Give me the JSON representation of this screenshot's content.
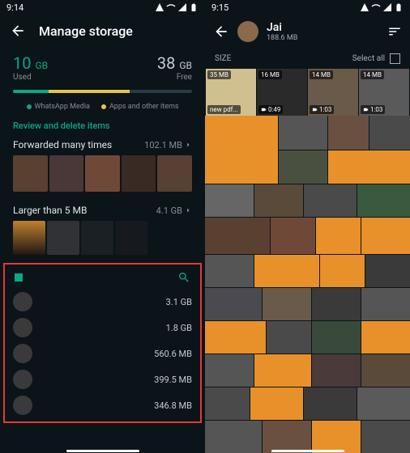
{
  "left": {
    "time": "9:14",
    "title": "Manage storage",
    "used_val": "10",
    "used_unit": "GB",
    "used_lbl": "Used",
    "free_val": "38",
    "free_unit": "GB",
    "free_lbl": "Free",
    "legend_wa": "WhatsApp Media",
    "legend_apps": "Apps and other items",
    "review_hdr": "Review and delete items",
    "fwd_title": "Forwarded many times",
    "fwd_size": "102.1 MB",
    "lg5_title": "Larger than 5 MB",
    "lg5_size": "4.1 GB",
    "chats": [
      {
        "size": "3.1 GB"
      },
      {
        "size": "1.8 GB"
      },
      {
        "size": "560.6 MB"
      },
      {
        "size": "399.5 MB"
      },
      {
        "size": "346.8 MB"
      }
    ]
  },
  "right": {
    "time": "9:15",
    "name": "Jai",
    "sub": "188.6 MB",
    "size_lbl": "SIZE",
    "select_all": "Select all",
    "top4": [
      {
        "size": "35 MB",
        "dur": "new pdf..."
      },
      {
        "size": "16 MB",
        "dur": "0:49"
      },
      {
        "size": "14 MB",
        "dur": "1:03"
      },
      {
        "size": "14 MB",
        "dur": "1:03"
      }
    ]
  }
}
